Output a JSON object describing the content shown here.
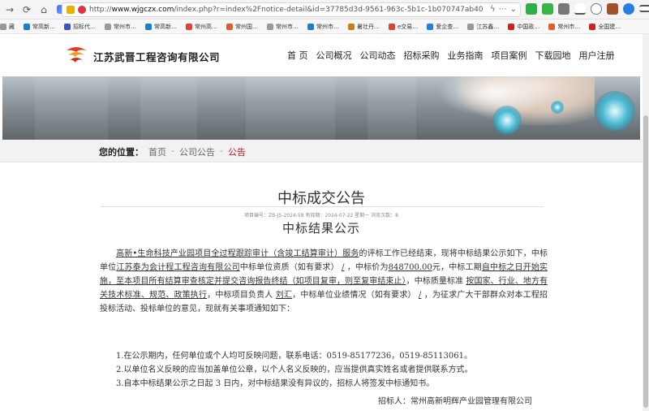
{
  "browser": {
    "url_prefix": "http://",
    "url_domain": "www.wjgczx.com",
    "url_path": "/index.php?r=index%2Fnotice-detail&id=37785d3d-9561-963c-5b1c-1b070747ab40"
  },
  "bookmarks": [
    {
      "label": "藏",
      "color": "#999"
    },
    {
      "label": "常高新…",
      "color": "#1a7fd1"
    },
    {
      "label": "招标代…",
      "color": "#3855c8"
    },
    {
      "label": "常州市…",
      "color": "#999"
    },
    {
      "label": "常高新…",
      "color": "#1a7fd1"
    },
    {
      "label": "常州高…",
      "color": "#d43"
    },
    {
      "label": "常州国…",
      "color": "#e0602a"
    },
    {
      "label": "常州市…",
      "color": "#999"
    },
    {
      "label": "常州市…",
      "color": "#1a7fd1"
    },
    {
      "label": "暑壮丹…",
      "color": "#d07a18"
    },
    {
      "label": "e交易…",
      "color": "#d43"
    },
    {
      "label": "爱企查…",
      "color": "#2a7de0"
    },
    {
      "label": "江苏鑫…",
      "color": "#999"
    },
    {
      "label": "中国政…",
      "color": "#c22"
    },
    {
      "label": "常州市…",
      "color": "#e0602a"
    },
    {
      "label": "全国建…",
      "color": "#c22"
    }
  ],
  "site": {
    "name": "江苏武晋工程咨询有限公司",
    "nav": [
      "首 页",
      "公司概况",
      "公司动态",
      "招标采购",
      "业务指南",
      "项目案例",
      "下载园地",
      "用户注册"
    ]
  },
  "breadcrumb": {
    "label": "您的位置：",
    "home": "首页",
    "sep": "-",
    "section": "公司公告",
    "current": "公告"
  },
  "article": {
    "title": "中标成交公告",
    "meta": "项目编号：ZB-JS-2024-58 有效期：2024-07-22 星期一 浏览次数：8",
    "subtitle": "中标结果公示",
    "p1_project": "高新•生命科技产业园项目全过程跟踪审计（含竣工结算审计）服务",
    "p1_a": "的评标工作已经结束，现将中标结果公示如下，中标单位",
    "p1_winner": "江苏泰为会计程工程咨询有限公司",
    "p1_b": "中标单位资质（如有要求）",
    "p1_qual": "/",
    "p1_c": "，中标价为",
    "p1_price": "848700.00",
    "p1_d": "元，中标工期",
    "p1_period": "自中标之日开始实施，至本项目所有结算审查核定并提交咨询报告终结（如项目复审，则至复审结束止）",
    "p1_e": "，中标质量标准",
    "p1_quality": "按国家、行业、地方有关技术标准、规范、政策执行",
    "p1_f": "，中标项目负责人",
    "p1_manager": "刘汇",
    "p1_g": "，中标单位业绩情况（如有要求）",
    "p1_perf": "/",
    "p1_h": "，为征求广大干部群众对本工程招投标活动、投标单位的意见，现就有关事项通知如下：",
    "items": [
      "1.在公示期内，任何单位或个人均可反映问题，联系电话：0519-85177236，0519-85113061。",
      "2.以单位名义反映的应当加盖单位公章，以个人名义反映的，应当提供真实姓名或者提供联系方式。",
      "3.自本中标结果公示之日起 3 日内，对中标结果没有异议的，招标人将签发中标通知书。"
    ],
    "signature": "招标人：常州高新明辉产业园管理有限公司"
  }
}
